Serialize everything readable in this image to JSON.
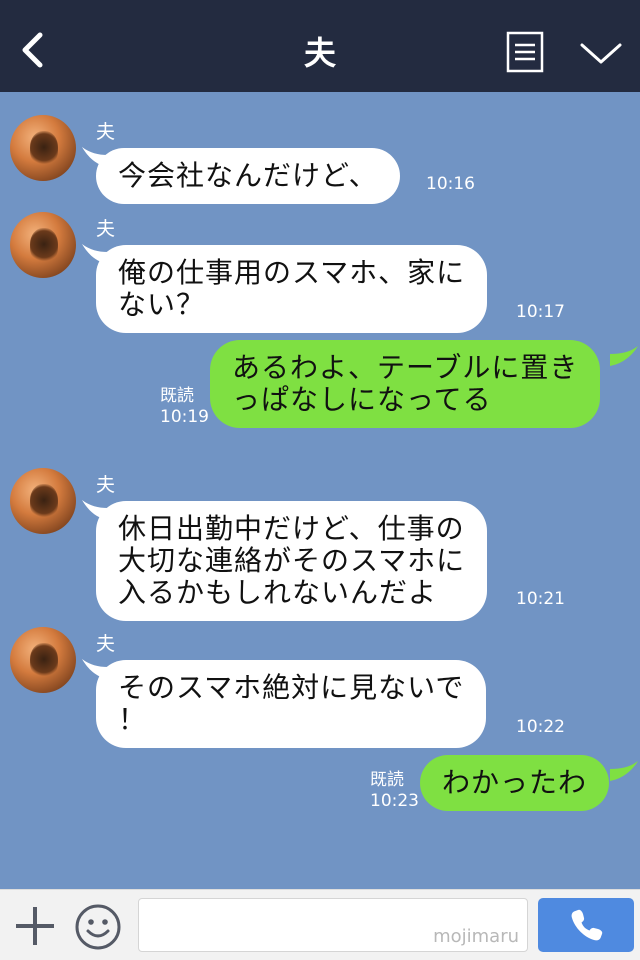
{
  "header": {
    "title": "夫",
    "back_icon": "chevron-left-icon",
    "menu_icon": "note-icon",
    "expand_icon": "chevron-down-icon"
  },
  "messages": [
    {
      "sender": "夫",
      "direction": "in",
      "text": "今会社なんだけど、",
      "time": "10:16"
    },
    {
      "sender": "夫",
      "direction": "in",
      "text": "俺の仕事用のスマホ、家に\nない？",
      "time": "10:17"
    },
    {
      "direction": "out",
      "text": "あるわよ、テーブルに置き\nっぱなしになってる",
      "read": "既読",
      "time": "10:19"
    },
    {
      "sender": "夫",
      "direction": "in",
      "text": "休日出勤中だけど、仕事の\n大切な連絡がそのスマホに\n入るかもしれないんだよ",
      "time": "10:21"
    },
    {
      "sender": "夫",
      "direction": "in",
      "text": "そのスマホ絶対に見ないで\n！",
      "time": "10:22"
    },
    {
      "direction": "out",
      "text": "わかったわ",
      "read": "既読",
      "time": "10:23"
    }
  ],
  "footer": {
    "plus_icon": "plus-icon",
    "sticker_icon": "smile-icon",
    "input_value": "",
    "watermark": "mojimaru",
    "call_icon": "phone-icon"
  },
  "colors": {
    "header_bg": "#232b40",
    "chat_bg": "#7194c4",
    "incoming_bubble": "#ffffff",
    "outgoing_bubble": "#7fe042",
    "call_button": "#4f8ae0"
  }
}
